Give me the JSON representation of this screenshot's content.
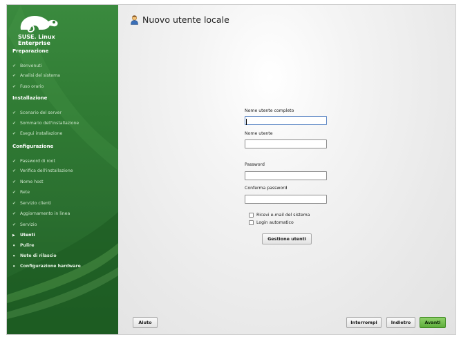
{
  "brand": {
    "line1": "SUSE. Linux",
    "line2": "Enterprise"
  },
  "sidebar": {
    "sections": [
      {
        "title": "Preparazione",
        "steps": [
          {
            "label": "Benvenuti",
            "state": "done"
          },
          {
            "label": "Analisi del sistema",
            "state": "done"
          },
          {
            "label": "Fuso orario",
            "state": "done"
          }
        ]
      },
      {
        "title": "Installazione",
        "steps": [
          {
            "label": "Scenario del server",
            "state": "done"
          },
          {
            "label": "Sommario dell'installazione",
            "state": "done"
          },
          {
            "label": "Esegui installazione",
            "state": "done"
          }
        ]
      },
      {
        "title": "Configurazione",
        "steps": [
          {
            "label": "Password di root",
            "state": "done"
          },
          {
            "label": "Verifica dell'installazione",
            "state": "done"
          },
          {
            "label": "Nome host",
            "state": "done"
          },
          {
            "label": "Rete",
            "state": "done"
          },
          {
            "label": "Servizio clienti",
            "state": "done"
          },
          {
            "label": "Aggiornamento in linea",
            "state": "done"
          },
          {
            "label": "Servizio",
            "state": "done"
          },
          {
            "label": "Utenti",
            "state": "current"
          },
          {
            "label": "Pulire",
            "state": "future"
          },
          {
            "label": "Note di rilascio",
            "state": "future"
          },
          {
            "label": "Configurazione hardware",
            "state": "future"
          }
        ]
      }
    ]
  },
  "main": {
    "title": "Nuovo utente locale",
    "form": {
      "full_name_label": "Nome utente completo",
      "full_name_value": "",
      "username_label": "Nome utente",
      "username_value": "",
      "password_label": "Password",
      "password_value": "",
      "confirm_label": "Conferma password",
      "confirm_value": "",
      "receive_mail_label": "Ricevi e-mail del sistema",
      "receive_mail_checked": false,
      "autologin_label": "Login automatico",
      "autologin_checked": false,
      "manage_users_label": "Gestione utenti"
    }
  },
  "footer": {
    "help_label": "Aiuto",
    "abort_label": "Interrompi",
    "back_label": "Indietro",
    "next_label": "Avanti"
  },
  "colors": {
    "sidebar_green": "#2f7a33",
    "next_button": "#6cbc45",
    "focus_border": "#5b86c4"
  },
  "icons": {
    "logo": "suse-chameleon-logo",
    "done": "check-icon",
    "current": "arrow-right-icon",
    "future": "bullet-icon",
    "title": "user-icon"
  }
}
